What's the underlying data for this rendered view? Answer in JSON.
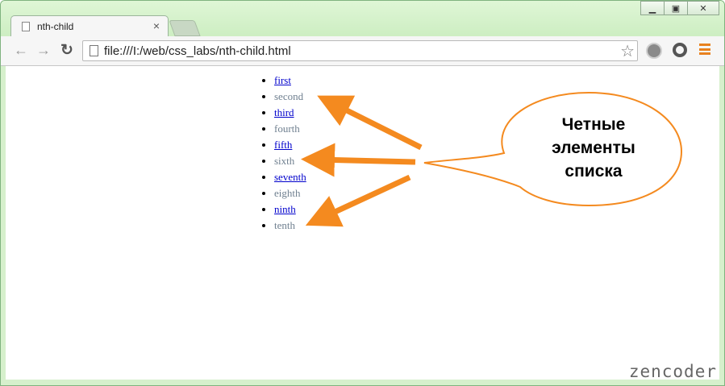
{
  "window": {
    "controls": [
      "minimize",
      "maximize",
      "close"
    ]
  },
  "tab": {
    "title": "nth-child",
    "close_glyph": "×",
    "icon": "page-icon"
  },
  "toolbar": {
    "back_glyph": "←",
    "forward_glyph": "→",
    "reload_glyph": "↻",
    "url": "file:///I:/web/css_labs/nth-child.html",
    "star_glyph": "☆"
  },
  "list": {
    "items": [
      {
        "label": "first",
        "style": "link"
      },
      {
        "label": "second",
        "style": "even"
      },
      {
        "label": "third",
        "style": "link"
      },
      {
        "label": "fourth",
        "style": "even"
      },
      {
        "label": "fifth",
        "style": "link"
      },
      {
        "label": "sixth",
        "style": "even"
      },
      {
        "label": "seventh",
        "style": "link"
      },
      {
        "label": "eighth",
        "style": "even"
      },
      {
        "label": "ninth",
        "style": "link"
      },
      {
        "label": "tenth",
        "style": "even"
      }
    ]
  },
  "callout": {
    "line1": "Четные",
    "line2": "элементы",
    "line3": "списка",
    "accent": "#f48a1f"
  },
  "watermark": "zencoder",
  "colors": {
    "link": "#0000cc",
    "even": "#708090",
    "frame": "#d6f0cc"
  }
}
